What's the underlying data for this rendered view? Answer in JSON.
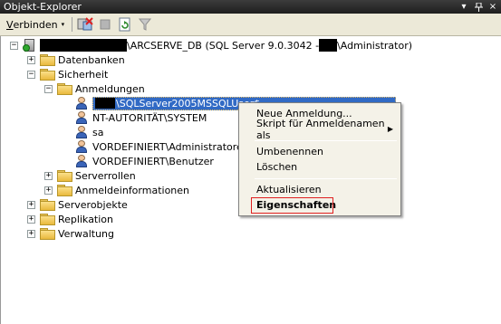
{
  "window": {
    "title": "Objekt-Explorer",
    "pin_glyph": "ᵻ",
    "close_glyph": "×"
  },
  "toolbar": {
    "connect_label": "Verbinden",
    "connect_hotkey": "V",
    "connect_rest": "erbinden",
    "caret": "▾",
    "icons": [
      "connect-object-explorer-icon",
      "disconnect-icon",
      "stop-icon",
      "refresh-icon",
      "filter-icon"
    ]
  },
  "tree": {
    "root": {
      "label": "\\ARCSERVE_DB (SQL Server 9.0.3042 - ",
      "label_suffix": "\\Administrator)",
      "expander": "−"
    },
    "nodes": [
      {
        "label": "Datenbanken",
        "expander": "+"
      },
      {
        "label": "Sicherheit",
        "expander": "−"
      },
      {
        "label": "Anmeldungen",
        "expander": "−"
      },
      {
        "label": "\\SQLServer2005MSSQLUser$"
      },
      {
        "label": "NT-AUTORITÄT\\SYSTEM"
      },
      {
        "label": "sa"
      },
      {
        "label": "VORDEFINIERT\\Administratoren"
      },
      {
        "label": "VORDEFINIERT\\Benutzer"
      },
      {
        "label": "Serverrollen",
        "expander": "+"
      },
      {
        "label": "Anmeldeinformationen",
        "expander": "+"
      },
      {
        "label": "Serverobjekte",
        "expander": "+"
      },
      {
        "label": "Replikation",
        "expander": "+"
      },
      {
        "label": "Verwaltung",
        "expander": "+"
      }
    ]
  },
  "context_menu": {
    "items": [
      {
        "label": "Neue Anmeldung..."
      },
      {
        "label": "Skript für Anmeldenamen als",
        "submenu_arrow": "▶"
      },
      {
        "label": "Umbenennen"
      },
      {
        "label": "Löschen"
      },
      {
        "label": "Aktualisieren"
      },
      {
        "label": "Eigenschaften"
      }
    ],
    "highlight_color": "#e02020"
  },
  "colors": {
    "selection": "#316ac5",
    "toolbar_bg": "#ece9d8",
    "titlebar_bg": "#2a2a2a"
  }
}
